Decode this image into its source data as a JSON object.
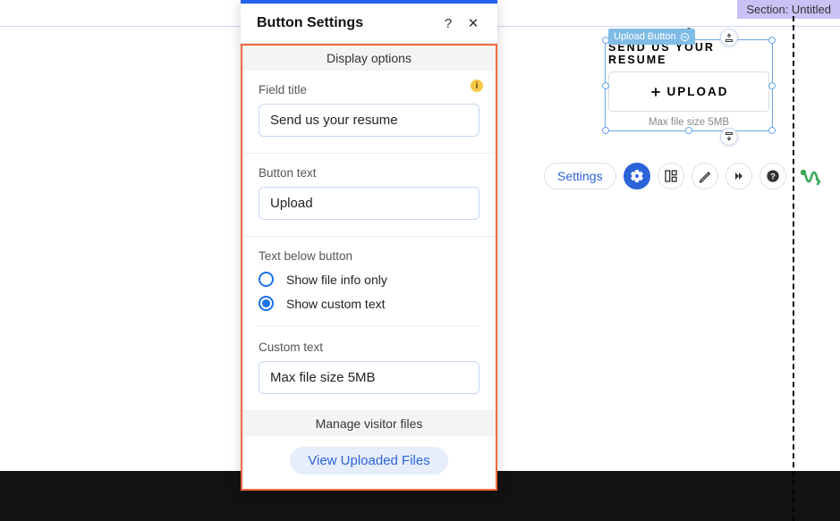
{
  "section_badge": "Section: Untitled",
  "panel": {
    "title": "Button Settings",
    "display_options_header": "Display options",
    "field_title_label": "Field title",
    "field_title_value": "Send us your resume",
    "button_text_label": "Button text",
    "button_text_value": "Upload",
    "text_below_label": "Text below button",
    "radio_file_info": "Show file info only",
    "radio_custom": "Show custom text",
    "custom_text_label": "Custom text",
    "custom_text_value": "Max file size 5MB",
    "manage_header": "Manage visitor files",
    "view_files_btn": "View Uploaded Files"
  },
  "widget": {
    "chip": "Upload Button",
    "field_title": "Send us your resume",
    "button": "UPLOAD",
    "below": "Max file size 5MB"
  },
  "toolbar": {
    "settings": "Settings"
  }
}
